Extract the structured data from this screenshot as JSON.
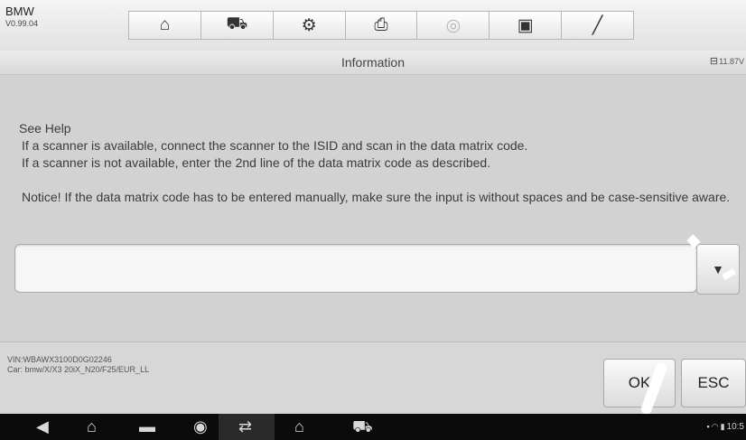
{
  "app": {
    "name": "BMW",
    "version": "V0.99.04"
  },
  "toolbar": {
    "items": [
      {
        "icon": "home-icon",
        "glyph": "⌂"
      },
      {
        "icon": "car-icon",
        "glyph": "⛟"
      },
      {
        "icon": "settings-icon",
        "glyph": "⚙"
      },
      {
        "icon": "print-icon",
        "glyph": "⎙"
      },
      {
        "icon": "help-icon",
        "glyph": "◎"
      },
      {
        "icon": "save-icon",
        "glyph": "▣"
      },
      {
        "icon": "pen-icon",
        "glyph": "╱"
      }
    ]
  },
  "header": {
    "title": "Information",
    "battery_voltage": "11.87V"
  },
  "message": {
    "heading": "See Help",
    "line1": "If a scanner is available, connect the scanner to the ISID and scan in the data matrix code.",
    "line2": "If a scanner is not available, enter the 2nd line of the data matrix code as described.",
    "notice": "Notice! If the data matrix code has to be entered manually, make sure the input is without spaces and be case-sensitive aware."
  },
  "input": {
    "value": "",
    "dropdown_glyph": "▼"
  },
  "vehicle": {
    "vin": "VIN:WBAWX3100D0G02246",
    "car": "Car: bmw/X/X3 20iX_N20/F25/EUR_LL"
  },
  "buttons": {
    "ok": "OK",
    "esc": "ESC"
  },
  "navbar": {
    "icons": [
      {
        "name": "back-icon",
        "glyph": "◀"
      },
      {
        "name": "home-icon",
        "glyph": "⌂"
      },
      {
        "name": "recent-apps-icon",
        "glyph": "▬"
      },
      {
        "name": "browser-icon",
        "glyph": "◉"
      },
      {
        "name": "vci-icon",
        "glyph": "⇄"
      },
      {
        "name": "maxisys-home-icon",
        "glyph": "⌂"
      },
      {
        "name": "car-icon",
        "glyph": "⛟"
      }
    ],
    "time": "10:5"
  }
}
